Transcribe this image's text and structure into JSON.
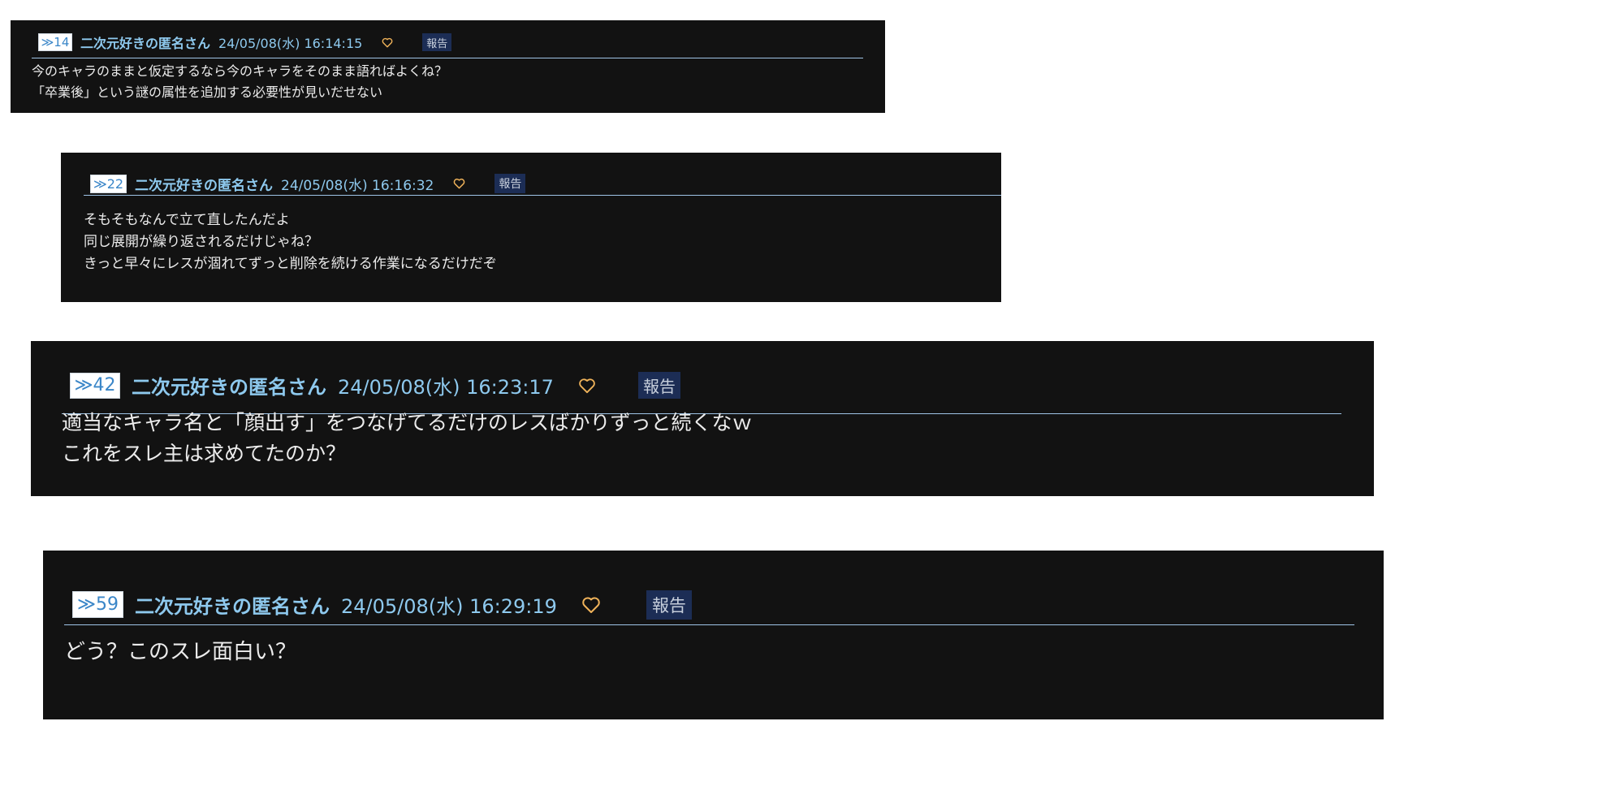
{
  "colors": {
    "post_background": "#121212",
    "author_text": "#8ec9ee",
    "heart_icon": "#f0b35a",
    "report_background": "#1c2d55",
    "divider": "#9fc4e6"
  },
  "posts": [
    {
      "reply_label": "≫14",
      "author": "二次元好きの匿名さん",
      "date": "24/05/08(水) 16:14:15",
      "heart_icon": "heart-outline-icon",
      "report_label": "報告",
      "lines": [
        "今のキャラのままと仮定するなら今のキャラをそのまま語ればよくね？",
        "「卒業後」という謎の属性を追加する必要性が見いだせない"
      ]
    },
    {
      "reply_label": "≫22",
      "author": "二次元好きの匿名さん",
      "date": "24/05/08(水) 16:16:32",
      "heart_icon": "heart-outline-icon",
      "report_label": "報告",
      "lines": [
        "そもそもなんで立て直したんだよ",
        "同じ展開が繰り返されるだけじゃね？",
        "きっと早々にレスが涸れてずっと削除を続ける作業になるだけだぞ"
      ]
    },
    {
      "reply_label": "≫42",
      "author": "二次元好きの匿名さん",
      "date": "24/05/08(水) 16:23:17",
      "heart_icon": "heart-outline-icon",
      "report_label": "報告",
      "lines": [
        "適当なキャラ名と「顔出す」をつなげてるだけのレスばかりずっと続くなｗ",
        "これをスレ主は求めてたのか？"
      ]
    },
    {
      "reply_label": "≫59",
      "author": "二次元好きの匿名さん",
      "date": "24/05/08(水) 16:29:19",
      "heart_icon": "heart-outline-icon",
      "report_label": "報告",
      "lines": [
        "どう？このスレ面白い？"
      ]
    }
  ]
}
